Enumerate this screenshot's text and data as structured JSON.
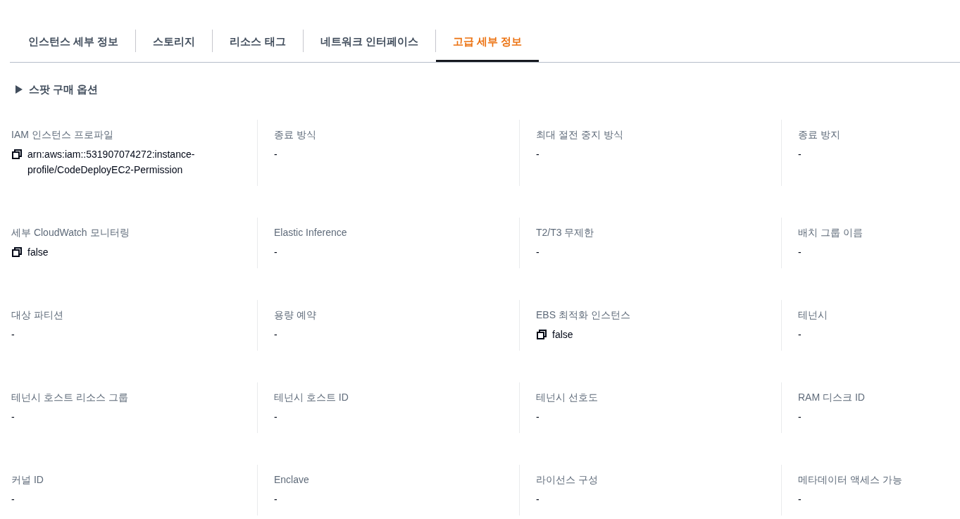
{
  "tabs": [
    {
      "label": "인스턴스 세부 정보",
      "selected": false
    },
    {
      "label": "스토리지",
      "selected": false
    },
    {
      "label": "리소스 태그",
      "selected": false
    },
    {
      "label": "네트워크 인터페이스",
      "selected": false
    },
    {
      "label": "고급 세부 정보",
      "selected": true
    }
  ],
  "expandable_section": {
    "title": "스팟 구매 옵션",
    "expanded": false
  },
  "details": [
    {
      "label": "IAM 인스턴스 프로파일",
      "value": "arn:aws:iam::531907074272:instance-profile/CodeDeployEC2-Permission",
      "copyable": true
    },
    {
      "label": "종료 방식",
      "value": "-",
      "copyable": false
    },
    {
      "label": "최대 절전 중지 방식",
      "value": "-",
      "copyable": false
    },
    {
      "label": "종료 방지",
      "value": "-",
      "copyable": false
    },
    {
      "label": "세부 CloudWatch 모니터링",
      "value": "false",
      "copyable": true
    },
    {
      "label": "Elastic Inference",
      "value": "-",
      "copyable": false
    },
    {
      "label": "T2/T3 무제한",
      "value": "-",
      "copyable": false
    },
    {
      "label": "배치 그룹 이름",
      "value": "-",
      "copyable": false
    },
    {
      "label": "대상 파티션",
      "value": "-",
      "copyable": false
    },
    {
      "label": "용량 예약",
      "value": "-",
      "copyable": false
    },
    {
      "label": "EBS 최적화 인스턴스",
      "value": "false",
      "copyable": true
    },
    {
      "label": "테넌시",
      "value": "-",
      "copyable": false
    },
    {
      "label": "테넌시 호스트 리소스 그룹",
      "value": "-",
      "copyable": false
    },
    {
      "label": "테넌시 호스트 ID",
      "value": "-",
      "copyable": false
    },
    {
      "label": "테넌시 선호도",
      "value": "-",
      "copyable": false
    },
    {
      "label": "RAM 디스크 ID",
      "value": "-",
      "copyable": false
    },
    {
      "label": "커널 ID",
      "value": "-",
      "copyable": false
    },
    {
      "label": "Enclave",
      "value": "-",
      "copyable": false
    },
    {
      "label": "라이선스 구성",
      "value": "-",
      "copyable": false
    },
    {
      "label": "메타데이터 액세스 가능",
      "value": "-",
      "copyable": false
    }
  ]
}
